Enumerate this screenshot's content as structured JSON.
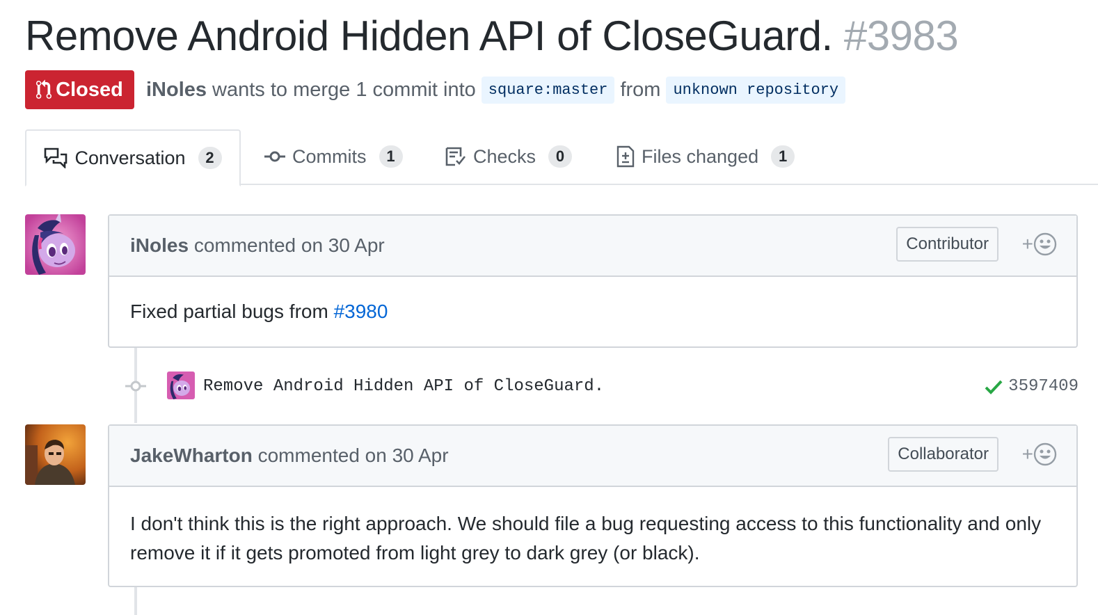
{
  "pr": {
    "title": "Remove Android Hidden API of CloseGuard.",
    "number": "#3983",
    "state": "Closed",
    "author": "iNoles",
    "merge_text": "wants to merge 1 commit into",
    "base_ref": "square:master",
    "from_text": "from",
    "head_ref": "unknown repository"
  },
  "tabs": [
    {
      "label": "Conversation",
      "count": "2",
      "icon": "comment-discussion-icon"
    },
    {
      "label": "Commits",
      "count": "1",
      "icon": "git-commit-icon"
    },
    {
      "label": "Checks",
      "count": "0",
      "icon": "checklist-icon"
    },
    {
      "label": "Files changed",
      "count": "1",
      "icon": "file-diff-icon"
    }
  ],
  "comments": [
    {
      "author": "iNoles",
      "action": "commented on 30 Apr",
      "role": "Contributor",
      "body_prefix": "Fixed partial bugs from ",
      "body_link": "#3980"
    },
    {
      "author": "JakeWharton",
      "action": "commented on 30 Apr",
      "role": "Collaborator",
      "body": "I don't think this is the right approach. We should file a bug requesting access to this functionality and only remove it if it gets promoted from light grey to dark grey (or black)."
    }
  ],
  "commit": {
    "message": "Remove Android Hidden API of CloseGuard.",
    "sha": "3597409",
    "status": "success"
  },
  "reaction_label": "+",
  "colors": {
    "closed": "#cb2431",
    "link": "#0366d6",
    "success": "#28a745"
  }
}
